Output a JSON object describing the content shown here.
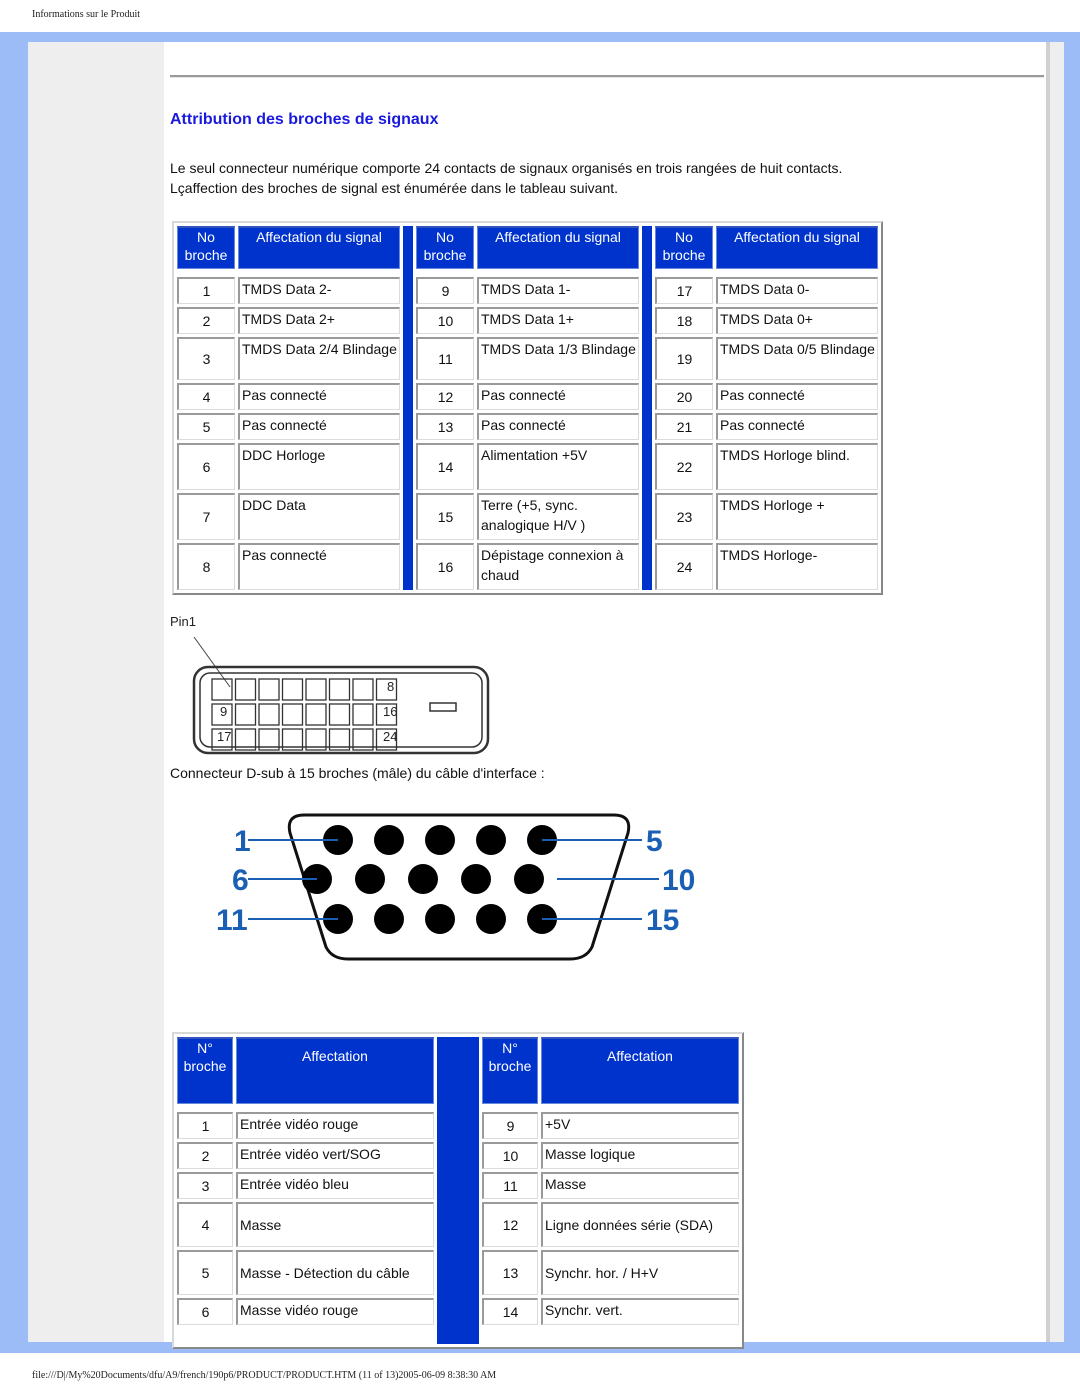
{
  "header": {
    "caption": "Informations sur le Produit"
  },
  "section": {
    "title": "Attribution des broches de signaux",
    "intro_line1": "Le seul connecteur numérique comporte 24 contacts de signaux organisés en trois rangées de huit contacts.",
    "intro_line2": "Lçaffection des broches de signal est énumérée dans le tableau suivant."
  },
  "dvi_table": {
    "headers": {
      "pin_line1": "No",
      "pin_line2": "broche",
      "signal": "Affectation du signal"
    },
    "rows": [
      [
        {
          "pin": "1",
          "signal": "TMDS Data 2-"
        },
        {
          "pin": "9",
          "signal": "TMDS Data 1-"
        },
        {
          "pin": "17",
          "signal": "TMDS Data 0-"
        }
      ],
      [
        {
          "pin": "2",
          "signal": "TMDS Data 2+"
        },
        {
          "pin": "10",
          "signal": "TMDS Data 1+"
        },
        {
          "pin": "18",
          "signal": "TMDS Data 0+"
        }
      ],
      [
        {
          "pin": "3",
          "signal": "TMDS Data 2/4 Blindage"
        },
        {
          "pin": "11",
          "signal": "TMDS Data 1/3 Blindage"
        },
        {
          "pin": "19",
          "signal": "TMDS Data 0/5 Blindage"
        }
      ],
      [
        {
          "pin": "4",
          "signal": "Pas connecté"
        },
        {
          "pin": "12",
          "signal": "Pas connecté"
        },
        {
          "pin": "20",
          "signal": "Pas connecté"
        }
      ],
      [
        {
          "pin": "5",
          "signal": "Pas connecté"
        },
        {
          "pin": "13",
          "signal": "Pas connecté"
        },
        {
          "pin": "21",
          "signal": "Pas connecté"
        }
      ],
      [
        {
          "pin": "6",
          "signal": "DDC Horloge"
        },
        {
          "pin": "14",
          "signal": "Alimentation +5V"
        },
        {
          "pin": "22",
          "signal": "TMDS Horloge blind."
        }
      ],
      [
        {
          "pin": "7",
          "signal": "DDC Data"
        },
        {
          "pin": "15",
          "signal": "Terre (+5, sync. analogique H/V )"
        },
        {
          "pin": "23",
          "signal": "TMDS Horloge +"
        }
      ],
      [
        {
          "pin": "8",
          "signal": "Pas connecté"
        },
        {
          "pin": "16",
          "signal": "Dépistage connexion à chaud"
        },
        {
          "pin": "24",
          "signal": "TMDS Horloge-"
        }
      ]
    ]
  },
  "dvi_diagram": {
    "pin1_label": "Pin1",
    "labels": {
      "r1_last": "8",
      "r2_first": "9",
      "r2_last": "16",
      "r3_first": "17",
      "r3_last": "24"
    }
  },
  "vga_caption": "Connecteur D-sub à 15 broches (mâle) du câble d'interface :",
  "vga_diagram": {
    "labels": {
      "r1_left": "1",
      "r1_right": "5",
      "r2_left": "6",
      "r2_right": "10",
      "r3_left": "11",
      "r3_right": "15"
    },
    "label_color": "#1a5fb4"
  },
  "vga_table": {
    "headers": {
      "pin_line1": "N°",
      "pin_line2": "broche",
      "signal": "Affectation"
    },
    "rows": [
      [
        {
          "pin": "1",
          "signal": "Entrée vidéo rouge"
        },
        {
          "pin": "9",
          "signal": "+5V"
        }
      ],
      [
        {
          "pin": "2",
          "signal": "Entrée vidéo vert/SOG"
        },
        {
          "pin": "10",
          "signal": "Masse logique"
        }
      ],
      [
        {
          "pin": "3",
          "signal": "Entrée vidéo bleu"
        },
        {
          "pin": "11",
          "signal": "Masse"
        }
      ],
      [
        {
          "pin": "4",
          "signal": "Masse"
        },
        {
          "pin": "12",
          "signal": "Ligne données série (SDA)"
        }
      ],
      [
        {
          "pin": "5",
          "signal": "Masse - Détection du câble"
        },
        {
          "pin": "13",
          "signal": "Synchr. hor. / H+V"
        }
      ],
      [
        {
          "pin": "6",
          "signal": "Masse vidéo rouge"
        },
        {
          "pin": "14",
          "signal": "Synchr. vert."
        }
      ]
    ]
  },
  "footer": {
    "path": "file:///D|/My%20Documents/dfu/A9/french/190p6/PRODUCT/PRODUCT.HTM (11 of 13)2005-06-09 8:38:30 AM"
  },
  "colors": {
    "frame": "#9bbcf7",
    "header_blue": "#0033cc",
    "title_blue": "#1a1adf"
  }
}
